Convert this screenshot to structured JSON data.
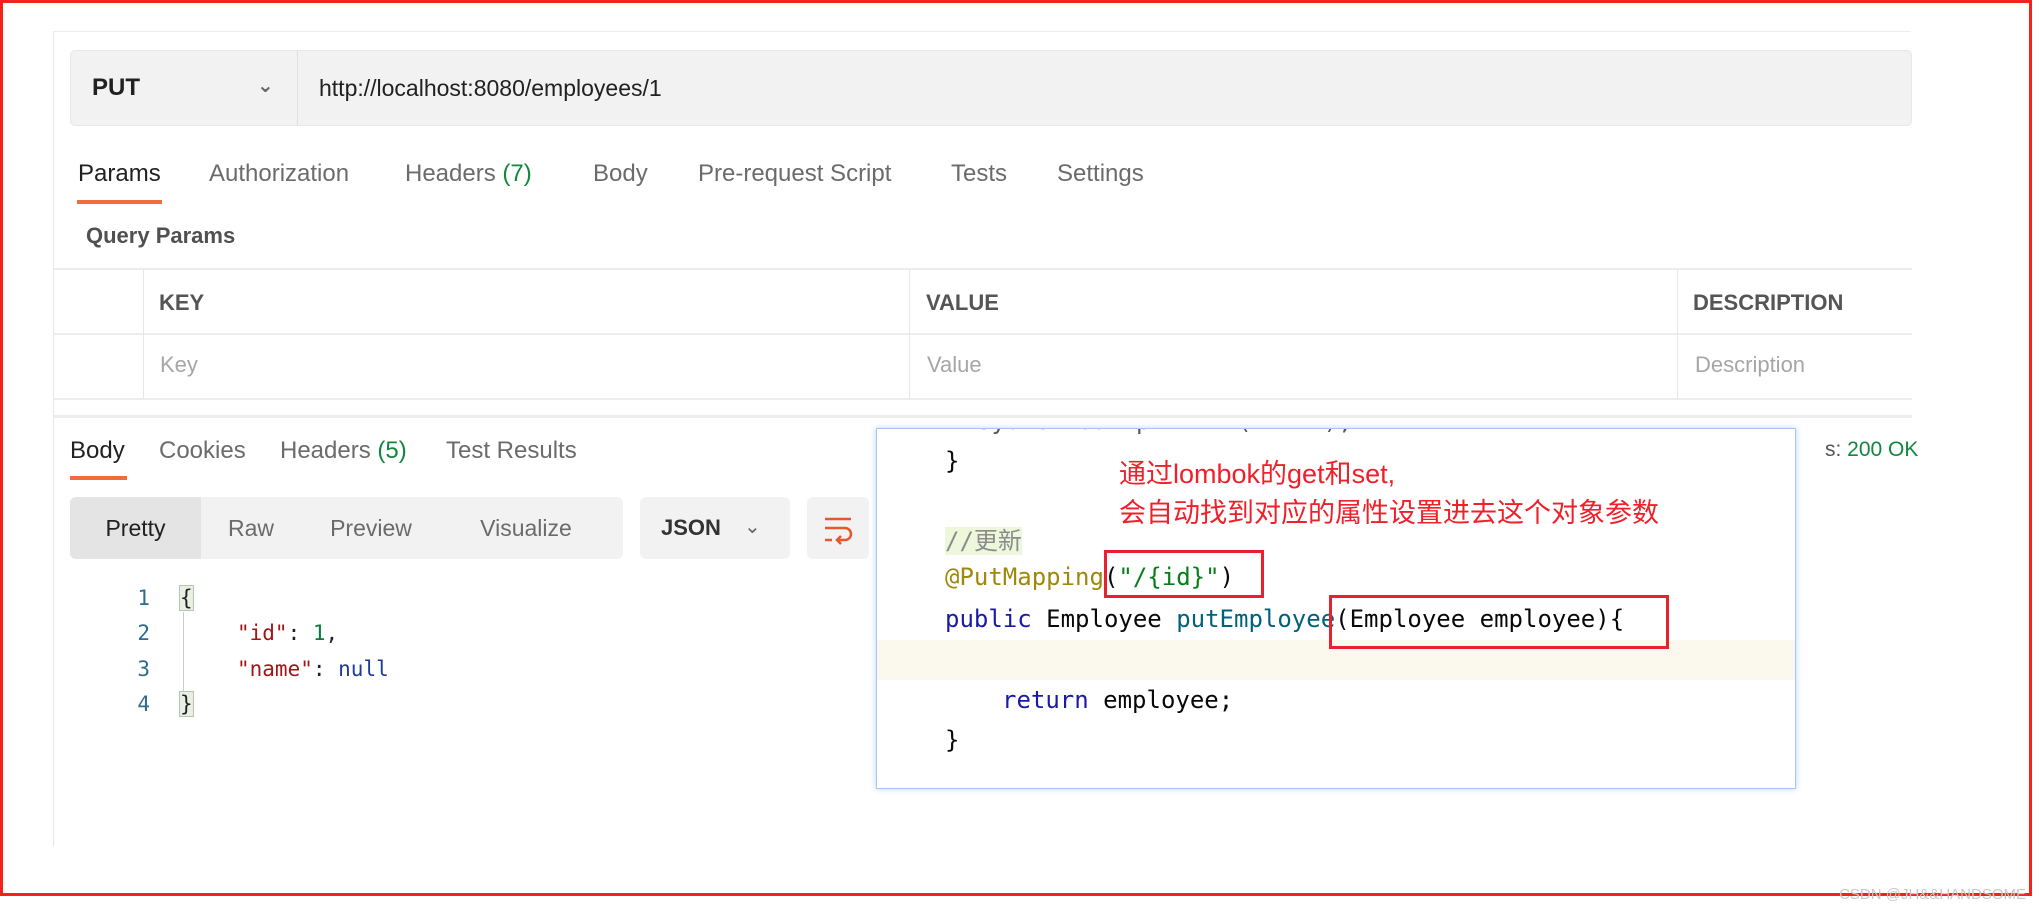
{
  "request": {
    "method": "PUT",
    "url": "http://localhost:8080/employees/1"
  },
  "request_tabs": [
    {
      "label": "Params"
    },
    {
      "label": "Authorization"
    },
    {
      "label": "Headers",
      "count": "(7)"
    },
    {
      "label": "Body"
    },
    {
      "label": "Pre-request Script"
    },
    {
      "label": "Tests"
    },
    {
      "label": "Settings"
    }
  ],
  "query_params": {
    "title": "Query Params",
    "headers": [
      "KEY",
      "VALUE",
      "DESCRIPTION"
    ],
    "placeholders": [
      "Key",
      "Value",
      "Description"
    ]
  },
  "response_tabs": [
    {
      "label": "Body"
    },
    {
      "label": "Cookies"
    },
    {
      "label": "Headers",
      "count": "(5)"
    },
    {
      "label": "Test Results"
    }
  ],
  "status": {
    "prefix": "s: ",
    "value": "200 OK"
  },
  "view_modes": [
    "Pretty",
    "Raw",
    "Preview",
    "Visualize"
  ],
  "format": "JSON",
  "response_body": {
    "line_numbers": [
      "1",
      "2",
      "3",
      "4"
    ],
    "open": "{",
    "id_key": "\"id\"",
    "id_value": "1",
    "name_key": "\"name\"",
    "name_value": "null",
    "close": "}"
  },
  "overlay": {
    "line_close1": "}",
    "comment": "//更新",
    "annotation": "@PutMapping",
    "annotation_arg": "\"/{id}\"",
    "kw_public": "public",
    "type": "Employee",
    "method": "putEmployee",
    "params": "(Employee employee){",
    "kw_return": "return",
    "return_val": " employee;",
    "line_close2": "}",
    "note_line1": "通过lombok的get和set,",
    "note_line2": "会自动找到对应的属性设置进去这个对象参数"
  },
  "watermark": "CSDN @JH&&HANDSOME",
  "colors": {
    "accent": "#f26b3a",
    "status_ok": "#0f8a3c",
    "annotation_red": "#e8212d"
  }
}
